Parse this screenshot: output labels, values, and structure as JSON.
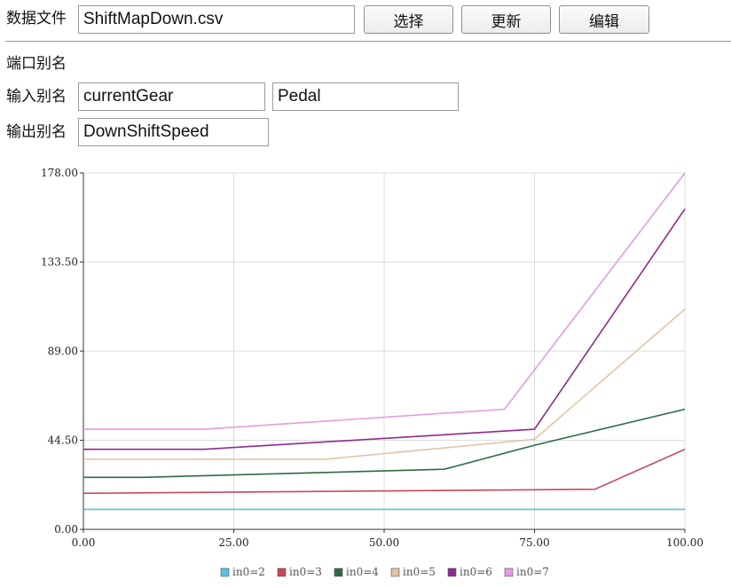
{
  "file": {
    "label": "数据文件",
    "value": "ShiftMapDown.csv",
    "select_label": "选择",
    "update_label": "更新",
    "edit_label": "编辑"
  },
  "ports": {
    "heading": "端口别名",
    "input_label": "输入别名",
    "input_values": [
      "currentGear",
      "Pedal"
    ],
    "output_label": "输出别名",
    "output_value": "DownShiftSpeed"
  },
  "colors": {
    "grid": "#dcdcdc",
    "axis": "#333333"
  },
  "chart_data": {
    "type": "line",
    "xlim": [
      0,
      100
    ],
    "ylim": [
      0,
      178
    ],
    "x_ticks": [
      "0.00",
      "25.00",
      "50.00",
      "75.00",
      "100.00"
    ],
    "y_ticks": [
      "0.00",
      "44.50",
      "89.00",
      "133.50",
      "178.00"
    ],
    "grid": true,
    "legend_position": "bottom",
    "series": [
      {
        "name": "in0=2",
        "color": "#5bc0de",
        "points": [
          [
            0,
            10
          ],
          [
            10,
            10
          ],
          [
            20,
            10
          ],
          [
            30,
            10
          ],
          [
            40,
            10
          ],
          [
            50,
            10
          ],
          [
            60,
            10
          ],
          [
            70,
            10
          ],
          [
            80,
            10
          ],
          [
            90,
            10
          ],
          [
            100,
            10
          ]
        ]
      },
      {
        "name": "in0=3",
        "color": "#c9485b",
        "points": [
          [
            0,
            18
          ],
          [
            85,
            20
          ],
          [
            100,
            40
          ]
        ]
      },
      {
        "name": "in0=4",
        "color": "#2e6b45",
        "points": [
          [
            0,
            26
          ],
          [
            10,
            26
          ],
          [
            60,
            30
          ],
          [
            75,
            42
          ],
          [
            100,
            60
          ]
        ]
      },
      {
        "name": "in0=5",
        "color": "#e0c4a3",
        "points": [
          [
            0,
            35
          ],
          [
            40,
            35
          ],
          [
            75,
            45
          ],
          [
            100,
            110
          ]
        ]
      },
      {
        "name": "in0=6",
        "color": "#8e2a8e",
        "points": [
          [
            0,
            40
          ],
          [
            20,
            40
          ],
          [
            75,
            50
          ],
          [
            100,
            160
          ]
        ]
      },
      {
        "name": "in0=7",
        "color": "#e79be0",
        "points": [
          [
            0,
            50
          ],
          [
            20,
            50
          ],
          [
            70,
            60
          ],
          [
            100,
            178
          ]
        ]
      }
    ]
  }
}
